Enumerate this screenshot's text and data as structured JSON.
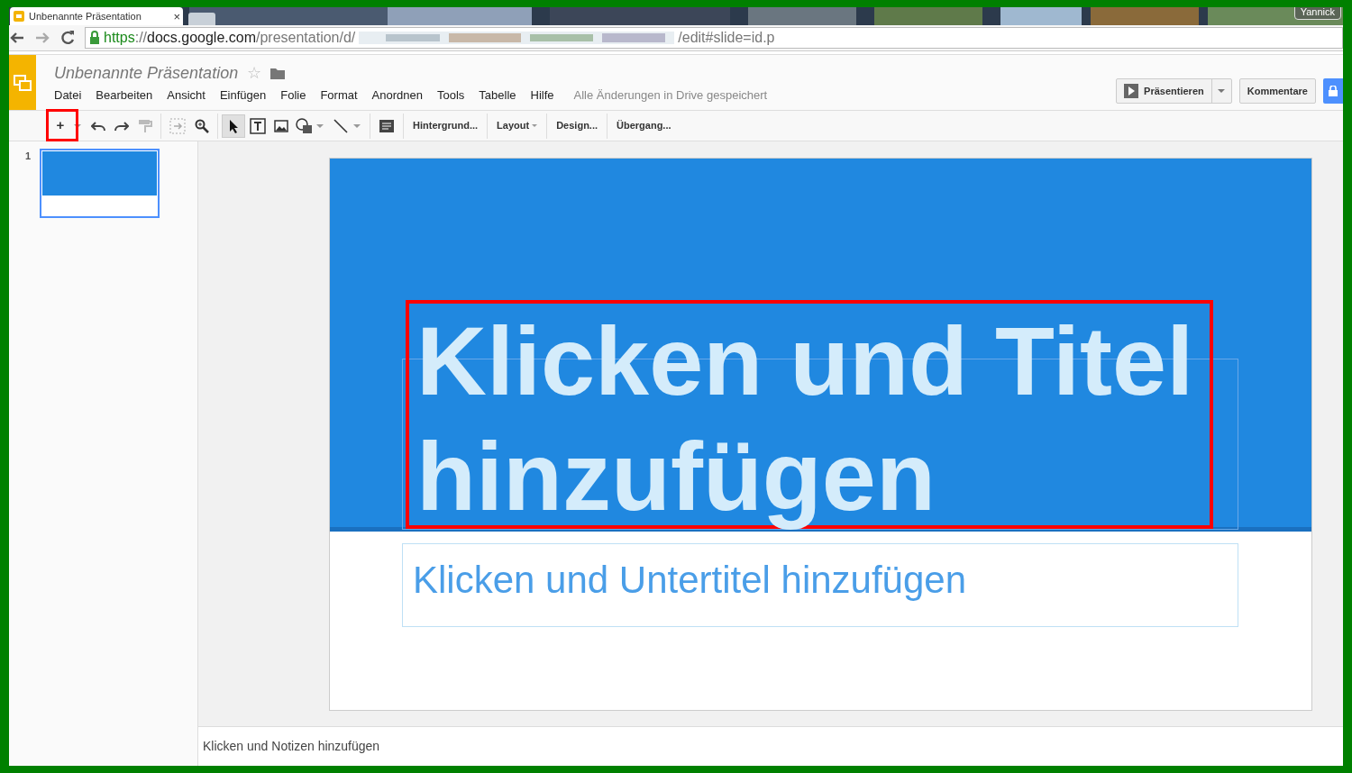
{
  "browser": {
    "tab_title": "Unbenannte Präsentation",
    "tab_close": "×",
    "user": "Yannick",
    "url_scheme": "https",
    "url_separator": "://",
    "url_host": "docs.google.com",
    "url_path_start": "/presentation/d/",
    "url_path_end": "/edit#slide=id.p"
  },
  "doc": {
    "title": "Unbenannte Präsentation",
    "starred": false,
    "star": "☆",
    "save_status": "Alle Änderungen in Drive gespeichert"
  },
  "menu": [
    "Datei",
    "Bearbeiten",
    "Ansicht",
    "Einfügen",
    "Folie",
    "Format",
    "Anordnen",
    "Tools",
    "Tabelle",
    "Hilfe"
  ],
  "actions": {
    "present": "Präsentieren",
    "comments": "Kommentare"
  },
  "toolbar": {
    "new_slide": "+",
    "text_buttons": [
      {
        "label": "Hintergrund...",
        "has_menu": false
      },
      {
        "label": "Layout",
        "has_menu": true
      },
      {
        "label": "Design...",
        "has_menu": false
      },
      {
        "label": "Übergang...",
        "has_menu": false
      }
    ]
  },
  "filmstrip": [
    {
      "number": "1",
      "selected": true
    }
  ],
  "slide": {
    "title": "Klicken und Titel hinzufügen",
    "subtitle": "Klicken und Untertitel hinzufügen"
  },
  "notes": {
    "placeholder": "Klicken und Notizen hinzufügen"
  },
  "highlights": {
    "new_slide_button": true,
    "title": true
  }
}
